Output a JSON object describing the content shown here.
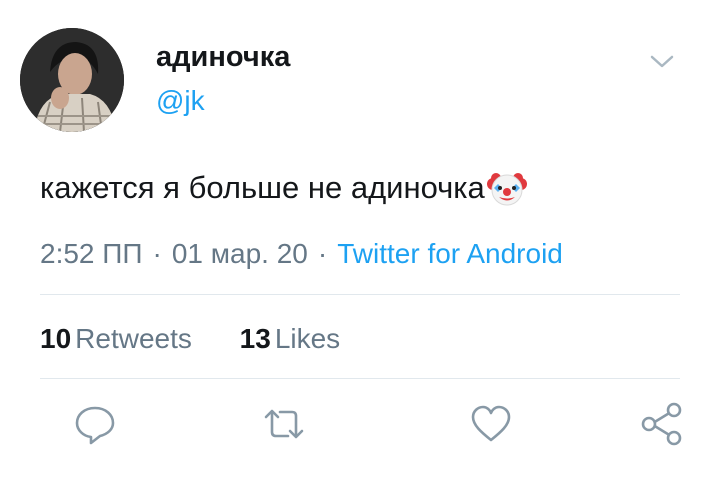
{
  "user": {
    "display_name": "адиночка",
    "handle": "@jk",
    "avatar": "profile-photo"
  },
  "tweet": {
    "text": "кажется я больше не адиночка",
    "emoji": "clown-face-emoji"
  },
  "meta": {
    "time": "2:52 ПП",
    "separator": "·",
    "date": "01 мар. 20",
    "source": "Twitter for Android"
  },
  "stats": {
    "retweets_count": "10",
    "retweets_label": "Retweets",
    "likes_count": "13",
    "likes_label": "Likes"
  },
  "actions": {
    "reply": "speech-bubble-icon",
    "retweet": "retweet-arrows-icon",
    "like": "heart-icon",
    "share": "share-nodes-icon",
    "menu": "chevron-down-icon"
  },
  "colors": {
    "accent": "#1da1f2",
    "text_primary": "#14171a",
    "text_secondary": "#657786",
    "icon": "#8899a6",
    "divider": "#e1e8ed"
  }
}
